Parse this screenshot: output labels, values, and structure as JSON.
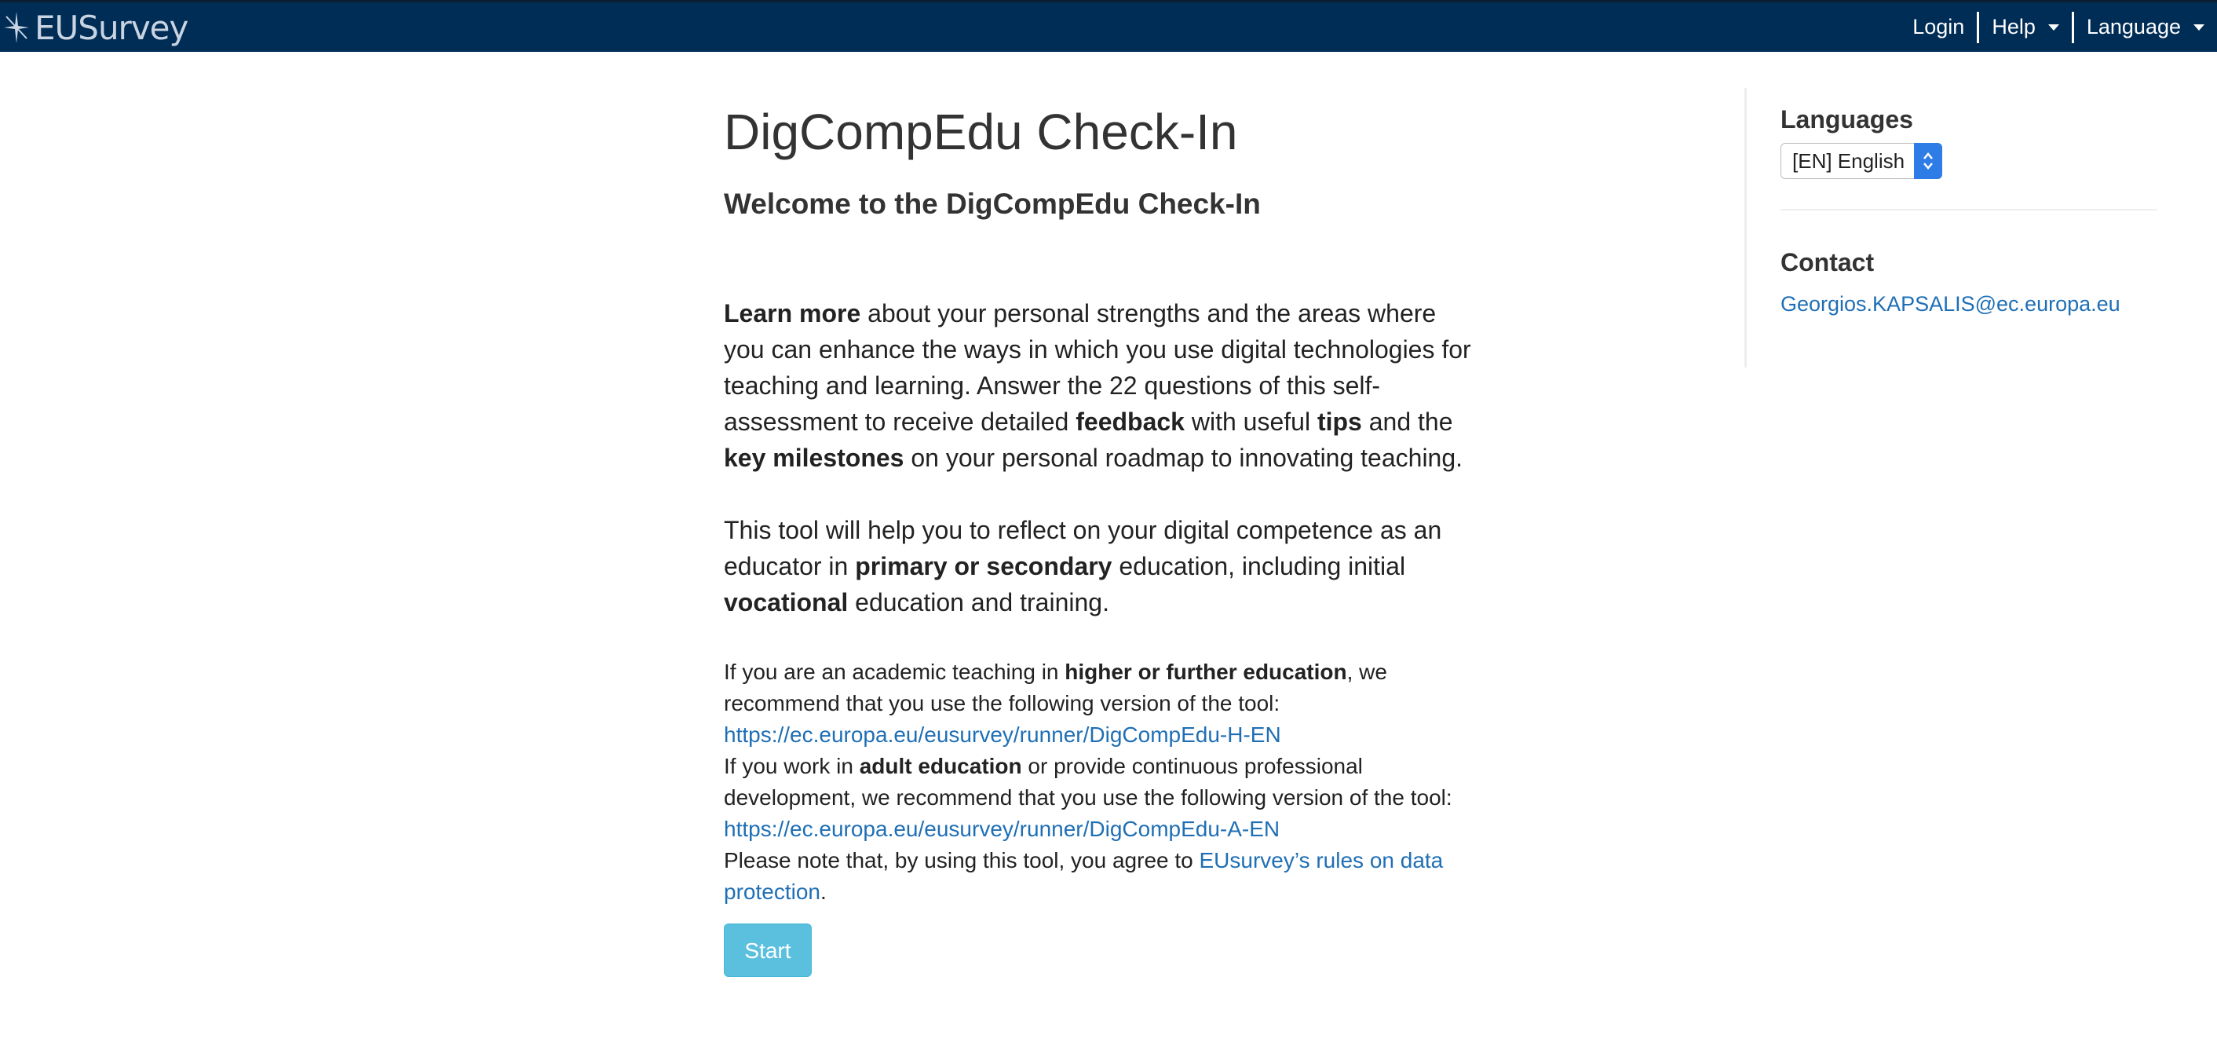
{
  "header": {
    "logo_text": "EUSurvey",
    "nav": [
      {
        "label": "Login"
      },
      {
        "label": "Help"
      },
      {
        "label": "Language"
      }
    ]
  },
  "main": {
    "title": "DigCompEdu Check-In",
    "subtitle": "Welcome to the DigCompEdu Check-In",
    "p1": {
      "b1": "Learn more",
      "t1": " about your personal strengths and the areas where you can enhance the ways in which you use digital technologies for teaching and learning. Answer the 22 questions of this self-assessment to receive detailed ",
      "b2": "feedback",
      "t2": " with useful ",
      "b3": "tips",
      "t3": " and the ",
      "b4": "key milestones",
      "t4": " on your personal roadmap to innovating teaching."
    },
    "p2": {
      "t1": "This tool will help you to reflect on your digital competence as an educator in ",
      "b1": "primary or secondary",
      "t2": " education, including initial ",
      "b2": "vocational",
      "t3": " education and training."
    },
    "p3": {
      "t1": "If you are an academic teaching in ",
      "b1": "higher or further education",
      "t2": ", we recommend that you use the following version of the tool:",
      "link1": "https://ec.europa.eu/eusurvey/runner/DigCompEdu-H-EN",
      "t3": "If you work in ",
      "b2": "adult education",
      "t4": " or provide continuous professional development, we recommend that you use the following version of the tool:",
      "link2": "https://ec.europa.eu/eusurvey/runner/DigCompEdu-A-EN",
      "t5": "Please note that, by using this tool, you agree to ",
      "link3": "EUsurvey’s rules on data protection",
      "t6": "."
    },
    "start_button": "Start"
  },
  "sidebar": {
    "languages_heading": "Languages",
    "language_selected": "[EN] English",
    "contact_heading": "Contact",
    "contact_email": "Georgios.KAPSALIS@ec.europa.eu"
  },
  "colors": {
    "header_bg": "#002d56",
    "link": "#1f6fb5",
    "start_button": "#5bc0de",
    "select_arrow": "#2e7ce6"
  },
  "icons": {
    "logo": "eusurvey-star-icon",
    "dropdown": "caret-down-icon",
    "select": "updown-arrows-icon"
  }
}
